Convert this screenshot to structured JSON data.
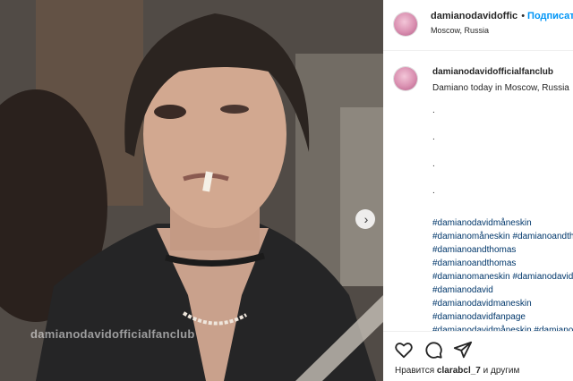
{
  "photo": {
    "watermark": "damianodavidofficialfanclub",
    "next_arrow": "chevron-right-icon"
  },
  "post_header": {
    "username": "damianodavidoffic",
    "dot": "•",
    "follow_label": "Подписаться",
    "location": "Moscow, Russia"
  },
  "caption": {
    "username": "damianodavidofficialfanclub",
    "text": "Damiano today in Moscow, Russia",
    "bullets": [
      ".",
      ".",
      ".",
      "."
    ],
    "hashtags": [
      "#damianodavidmåneskin",
      "#damianomåneskin #damianoandthomas",
      "#damianoandthomas",
      "#damianoandthomas",
      "#damianomaneskin #damianodavid",
      "#damianodavid",
      "#damianodavidmaneskin",
      "#damianodavidfanpage",
      "#damianodavidmåneskin #damianodavid"
    ]
  },
  "actions": {
    "icons": [
      "heart-icon",
      "comment-icon",
      "share-icon"
    ],
    "liked_prefix": "Нравится",
    "liked_user": "clarabcl_7",
    "liked_suffix": "и другим"
  }
}
